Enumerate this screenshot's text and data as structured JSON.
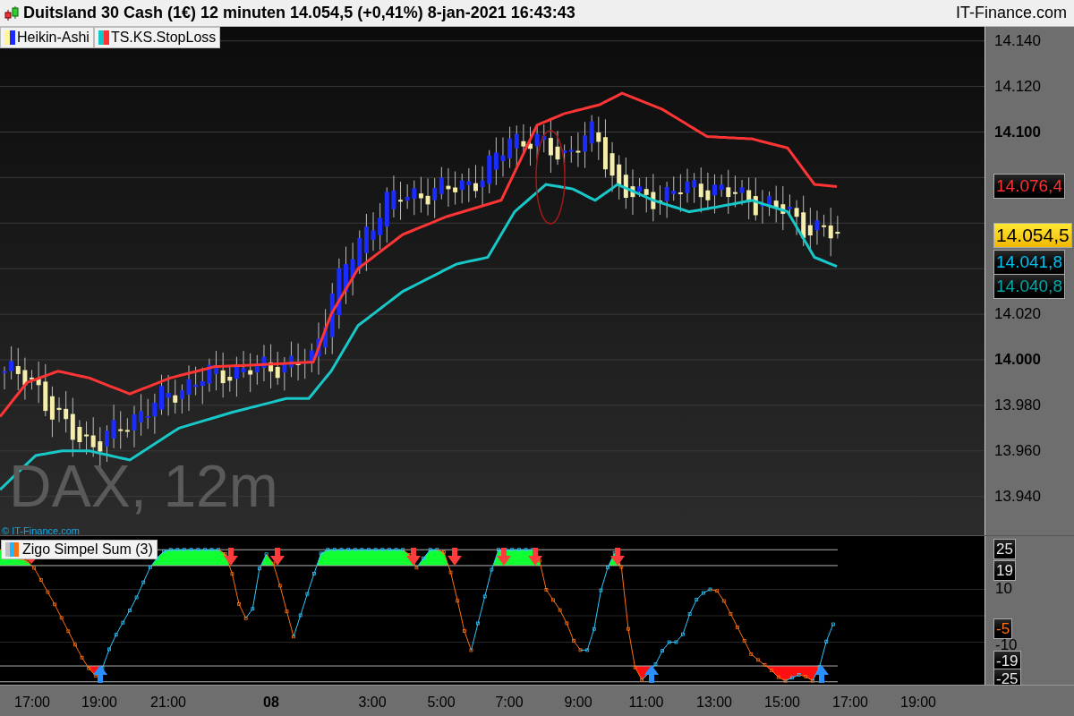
{
  "header": {
    "title": "Duitsland 30 Cash (1€) 12 minuten 14.054,5 (+0,41%) 8-jan-2021 16:43:43",
    "site": "IT-Finance.com"
  },
  "legend": [
    {
      "label": "Heikin-Ashi",
      "kind": "candles"
    },
    {
      "label": "TS.KS.StopLoss",
      "kind": "bands"
    }
  ],
  "watermark": "DAX, 12m",
  "copyright": "© IT-Finance.com",
  "price_axis": {
    "ticks": [
      {
        "label": "14.140",
        "major": false
      },
      {
        "label": "14.120",
        "major": false
      },
      {
        "label": "14.100",
        "major": true
      },
      {
        "label": "14.020",
        "major": false
      },
      {
        "label": "14.000",
        "major": true
      },
      {
        "label": "13.980",
        "major": false
      },
      {
        "label": "13.960",
        "major": false
      },
      {
        "label": "13.940",
        "major": false
      }
    ],
    "labels": [
      {
        "value": "14.076,4",
        "kind": "upper"
      },
      {
        "value": "14.054,5",
        "kind": "last"
      },
      {
        "value": "14.041,8",
        "kind": "lower"
      },
      {
        "value": "14.040,8",
        "kind": "previous"
      }
    ]
  },
  "indicator": {
    "label": "Zigo Simpel Sum (3)",
    "axis": [
      {
        "label": "25",
        "kind": "level"
      },
      {
        "label": "19",
        "kind": "level"
      },
      {
        "label": "10",
        "kind": "tick"
      },
      {
        "label": "-5",
        "kind": "value"
      },
      {
        "label": "-10",
        "kind": "tick"
      },
      {
        "label": "-19",
        "kind": "level"
      },
      {
        "label": "-25",
        "kind": "level"
      }
    ]
  },
  "time_axis": [
    {
      "label": "17:00",
      "major": false
    },
    {
      "label": "19:00",
      "major": false
    },
    {
      "label": "21:00",
      "major": false
    },
    {
      "label": "08",
      "major": true
    },
    {
      "label": "3:00",
      "major": false
    },
    {
      "label": "5:00",
      "major": false
    },
    {
      "label": "7:00",
      "major": false
    },
    {
      "label": "9:00",
      "major": false
    },
    {
      "label": "11:00",
      "major": false
    },
    {
      "label": "13:00",
      "major": false
    },
    {
      "label": "15:00",
      "major": false
    },
    {
      "label": "17:00",
      "major": false
    },
    {
      "label": "19:00",
      "major": false
    }
  ]
}
